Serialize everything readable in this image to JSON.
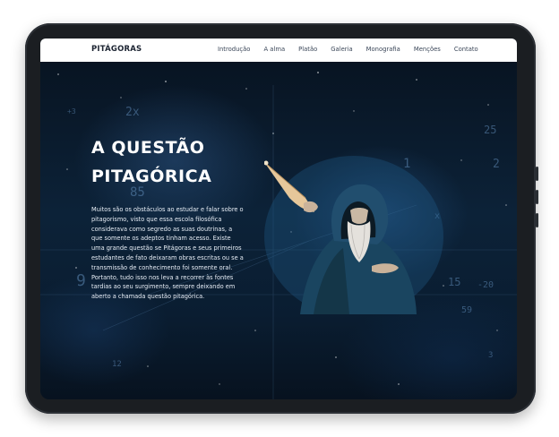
{
  "site": {
    "brand": "PITÁGORAS",
    "nav": [
      {
        "label": "Introdução"
      },
      {
        "label": "A alma"
      },
      {
        "label": "Platão"
      },
      {
        "label": "Galeria"
      },
      {
        "label": "Monografia"
      },
      {
        "label": "Menções"
      },
      {
        "label": "Contato"
      }
    ]
  },
  "hero": {
    "title_line1": "A QUESTÃO",
    "title_line2": "PITAGÓRICA",
    "paragraph": "Muitos são os obstáculos ao estudar e falar sobre o pitagorismo, visto que essa escola filosófica considerava como segredo as suas doutrinas, a que somente os adeptos tinham acesso. Existe uma grande questão se Pitágoras e seus primeiros estudantes de fato deixaram obras escritas ou se a transmissão de conhecimento foi somente oral. Portanto, tudo isso nos leva a recorrer às fontes tardias ao seu surgimento, sempre deixando em aberto a chamada questão pitagórica.",
    "image_subject": "hooded-sage-with-scroll"
  },
  "theme": {
    "nav_bg": "#ffffff",
    "hero_bg": "#0b1a2b",
    "text": "#ffffff",
    "device": "#1b1e22"
  }
}
